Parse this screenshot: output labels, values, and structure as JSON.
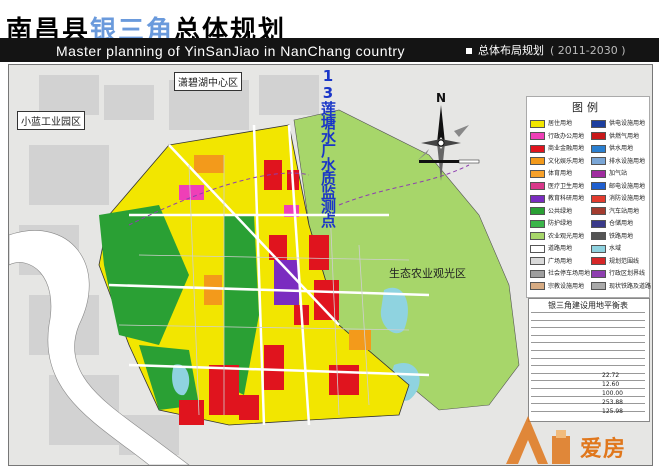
{
  "header": {
    "title_cn_part1": "南昌县",
    "title_cn_part2": "银三角",
    "title_cn_part3": "总体规划",
    "title_en": "Master planning of YinSanJiao in NanChang country",
    "subtitle": "总体布局规划",
    "period": "( 2011-2030 )"
  },
  "map": {
    "labels": {
      "district_1": "潇碧湖中心区",
      "district_2": "小蓝工业园区",
      "eco_zone": "生态农业观光区",
      "annotation": "13莲塘水厂水质监测点",
      "north": "N"
    },
    "colors": {
      "residential": "#f2e600",
      "commercial": "#e0141e",
      "green": "#2aa034",
      "agri": "#a7d66a",
      "admin": "#ef3fb7",
      "education": "#7a2cc0",
      "water": "#8fd3e0",
      "industry": "#b86a2a",
      "road": "#ffffff",
      "background": "#e8e8e8"
    }
  },
  "legend": {
    "title": "图例",
    "items": [
      "居住用地",
      "行政办公用地",
      "商业金融用地",
      "文化娱乐用地",
      "体育用地",
      "医疗卫生用地",
      "教育科研用地",
      "公共绿地",
      "防护绿地",
      "农业观光用地",
      "道路用地",
      "广场用地",
      "社会停车场用地",
      "宗教设施用地",
      "供电设施用地",
      "供燃气用地",
      "供水用地",
      "排水设施用地",
      "加气站",
      "邮电设施用地",
      "消防设施用地",
      "汽车站用地",
      "仓储用地",
      "铁路用地",
      "水域",
      "规划范围线",
      "行政区划界线",
      "现状铁路及道路"
    ]
  },
  "land_table": {
    "title": "银三角建设用地平衡表",
    "values": [
      "22.72",
      "12.60",
      "100.00",
      "253.88",
      "125.98"
    ]
  },
  "watermark": {
    "text": "爱房"
  }
}
